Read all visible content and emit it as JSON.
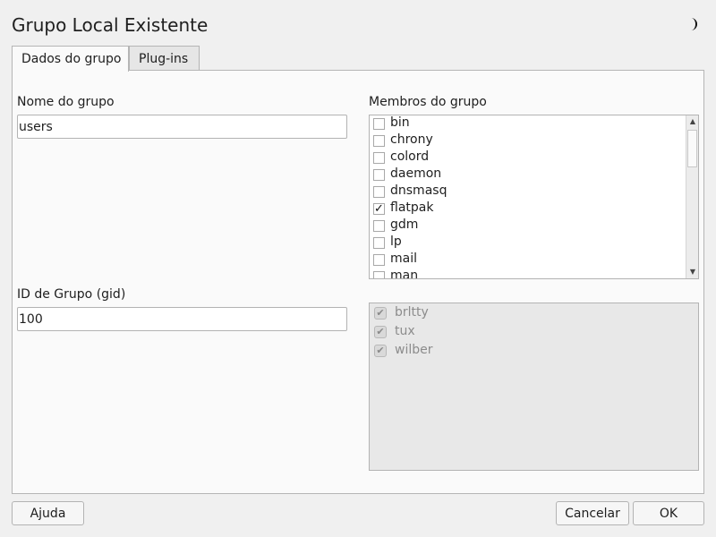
{
  "window": {
    "title": "Grupo Local Existente",
    "icon": "moon-icon"
  },
  "tabs": [
    {
      "label": "Dados do grupo",
      "active": true
    },
    {
      "label": "Plug-ins",
      "active": false
    }
  ],
  "form": {
    "group_name_label": "Nome do grupo",
    "group_name_value": "users",
    "gid_label": "ID de Grupo (gid)",
    "gid_value": "100",
    "members_label": "Membros do grupo"
  },
  "members_list": [
    {
      "label": "bin",
      "checked": false
    },
    {
      "label": "chrony",
      "checked": false
    },
    {
      "label": "colord",
      "checked": false
    },
    {
      "label": "daemon",
      "checked": false
    },
    {
      "label": "dnsmasq",
      "checked": false
    },
    {
      "label": "flatpak",
      "checked": true
    },
    {
      "label": "gdm",
      "checked": false
    },
    {
      "label": "lp",
      "checked": false
    },
    {
      "label": "mail",
      "checked": false
    },
    {
      "label": "man",
      "checked": false
    }
  ],
  "fixed_members": [
    {
      "label": "brltty",
      "checked": true
    },
    {
      "label": "tux",
      "checked": true
    },
    {
      "label": "wilber",
      "checked": true
    }
  ],
  "buttons": {
    "help": "Ajuda",
    "cancel": "Cancelar",
    "ok": "OK"
  }
}
